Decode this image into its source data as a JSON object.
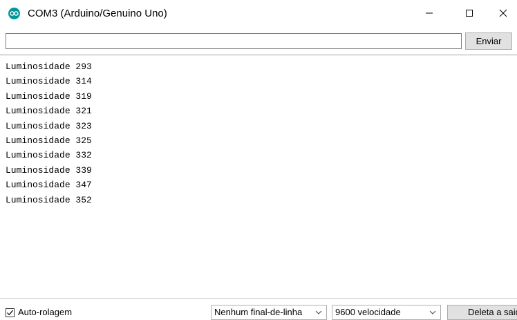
{
  "window": {
    "title": "COM3 (Arduino/Genuino Uno)",
    "icon": "arduino-icon",
    "controls": [
      "minimize-icon",
      "maximize-icon",
      "close-icon"
    ]
  },
  "send": {
    "input_value": "",
    "button_label": "Enviar"
  },
  "output": {
    "lines": [
      "Luminosidade 293",
      "Luminosidade 314",
      "Luminosidade 319",
      "Luminosidade 321",
      "Luminosidade 323",
      "Luminosidade 325",
      "Luminosidade 332",
      "Luminosidade 339",
      "Luminosidade 347",
      "Luminosidade 352"
    ]
  },
  "bottombar": {
    "autoscroll_label": "Auto-rolagem",
    "autoscroll_checked": true,
    "line_ending": "Nenhum final-de-linha",
    "baud_rate": "9600 velocidade",
    "clear_label": "Deleta a saida"
  },
  "colors": {
    "arduino_teal": "#00979c",
    "button_face": "#e1e1e1"
  }
}
